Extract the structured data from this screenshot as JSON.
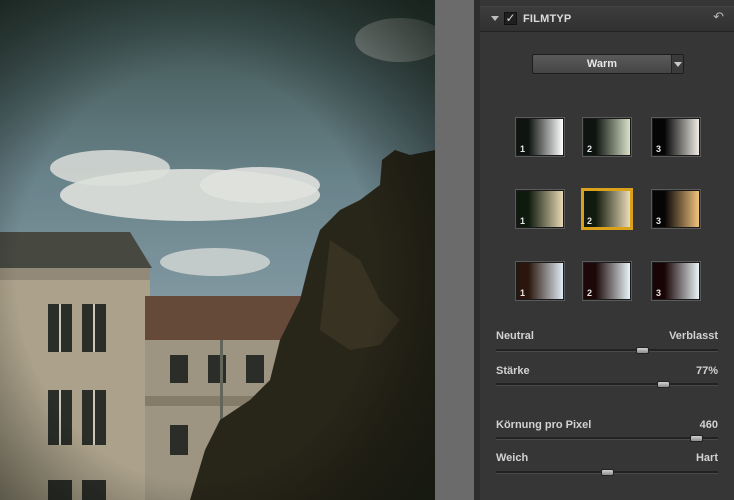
{
  "panel": {
    "title": "FILMTYP",
    "checkbox_mark": "✓",
    "reset_glyph": "↶",
    "accent_color": "#d9a21a"
  },
  "dropdown": {
    "value": "Warm"
  },
  "swatches": [
    {
      "num": "1",
      "colors": [
        "#0e1410",
        "#ffffff"
      ]
    },
    {
      "num": "2",
      "colors": [
        "#0e1510",
        "#d8e2c8"
      ]
    },
    {
      "num": "3",
      "colors": [
        "#050505",
        "#f0ece4"
      ]
    },
    {
      "num": "1",
      "colors": [
        "#0e1a0e",
        "#e8d8b4"
      ]
    },
    {
      "num": "2",
      "colors": [
        "#111a0e",
        "#eadcb8"
      ],
      "selected": true
    },
    {
      "num": "3",
      "colors": [
        "#050505",
        "#f4c47e"
      ]
    },
    {
      "num": "1",
      "colors": [
        "#2a160c",
        "#e0ecf4"
      ]
    },
    {
      "num": "2",
      "colors": [
        "#1c0808",
        "#e8f4f8"
      ]
    },
    {
      "num": "3",
      "colors": [
        "#180404",
        "#eaf4f8"
      ]
    }
  ],
  "sliders": {
    "tone": {
      "left": "Neutral",
      "right": "Verblasst",
      "position": 0.67
    },
    "strength": {
      "label": "Stärke",
      "value": "77%",
      "position": 0.77
    },
    "grain": {
      "label": "Körnung pro Pixel",
      "value": "460",
      "position": 0.93
    },
    "softness": {
      "left": "Weich",
      "right": "Hart",
      "position": 0.5
    }
  }
}
